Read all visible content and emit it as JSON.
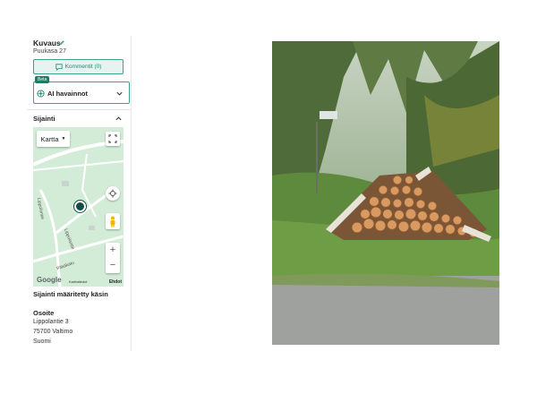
{
  "sidebar": {
    "description": {
      "title": "Kuvaus",
      "text": "Puukasa 27"
    },
    "comments_button": "Kommentit (0)",
    "ai": {
      "badge": "Beta",
      "label": "AI havainnot"
    },
    "location": {
      "title": "Sijainti",
      "map": {
        "type_label": "Kartta",
        "road_labels": [
          "Lippolantie",
          "Lippolantie",
          "Pitkäkatu"
        ],
        "google_label": "Google",
        "footer_label": "Karttatiedot",
        "terms_label": "Ehdot"
      },
      "method": "Sijainti määritetty käsin",
      "address": {
        "title": "Osoite",
        "lines": [
          "Lippolantie 3",
          "75700 Valtimo",
          "Suomi"
        ]
      }
    }
  },
  "colors": {
    "accent": "#1f8a75",
    "accent_light": "#e6f4f1",
    "map_green": "#d3ecd7",
    "marker": "#0f4d45"
  },
  "icons": [
    "edit-icon",
    "comment-icon",
    "ai-icon",
    "chevron-down-icon",
    "chevron-up-icon",
    "fullscreen-icon",
    "locate-icon",
    "pegman-icon"
  ]
}
